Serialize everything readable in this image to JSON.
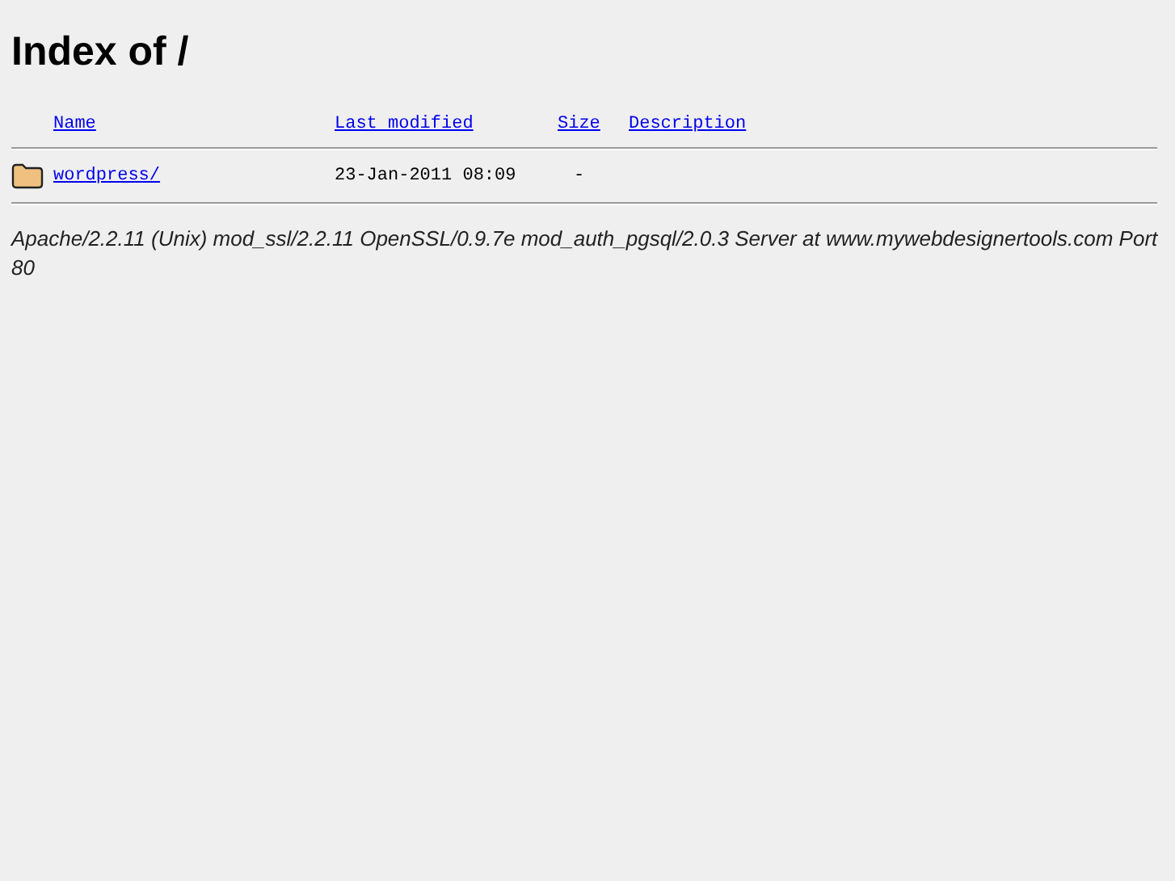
{
  "title": "Index of /",
  "columns": [
    "Name",
    "Last modified",
    "Size",
    "Description"
  ],
  "rows": [
    {
      "kind": "folder",
      "name": "wordpress/",
      "modified": "23-Jan-2011 08:09",
      "size": "-"
    }
  ],
  "address": "Apache/2.2.11 (Unix) mod_ssl/2.2.11 OpenSSL/0.9.7e mod_auth_pgsql/2.0.3 Server at www.mywebdesignertools.com Port 80"
}
